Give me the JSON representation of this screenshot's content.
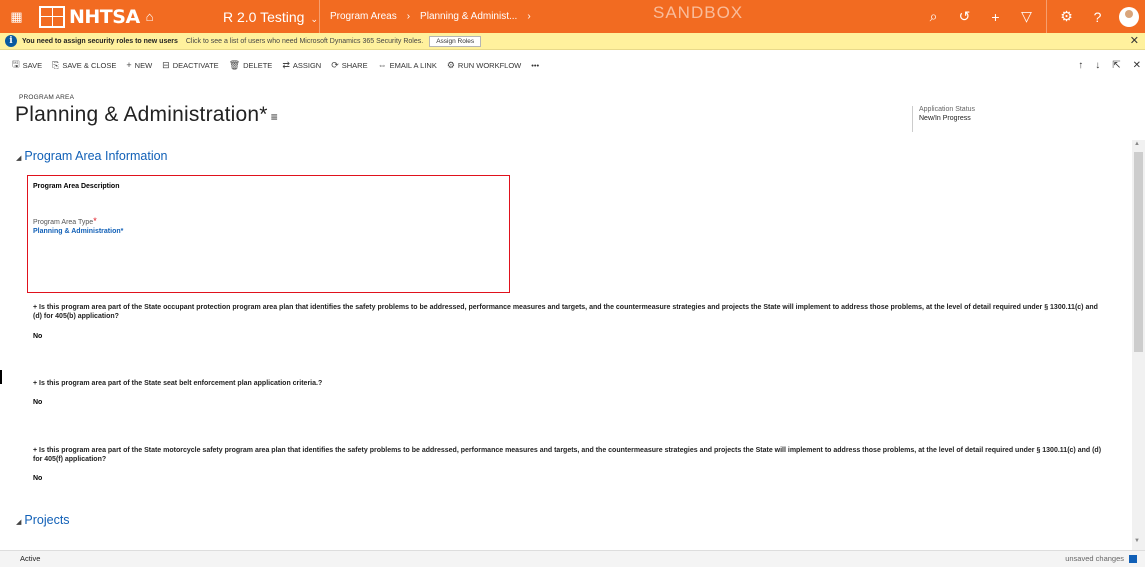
{
  "topbar": {
    "brand": "NHTSA",
    "environment": "R 2.0 Testing",
    "breadcrumbs": [
      "Program Areas",
      "Planning & Administ..."
    ],
    "watermark": "SANDBOX"
  },
  "notification": {
    "message": "You need to assign security roles to new users",
    "link_text": "Click to see a list of users who need Microsoft Dynamics 365 Security Roles.",
    "button_label": "Assign Roles"
  },
  "commands": [
    {
      "label": "SAVE",
      "icon": "save-icon"
    },
    {
      "label": "SAVE & CLOSE",
      "icon": "save-close-icon"
    },
    {
      "label": "NEW",
      "icon": "plus-icon"
    },
    {
      "label": "DEACTIVATE",
      "icon": "deactivate-icon"
    },
    {
      "label": "DELETE",
      "icon": "trash-icon"
    },
    {
      "label": "ASSIGN",
      "icon": "assign-icon"
    },
    {
      "label": "SHARE",
      "icon": "share-icon"
    },
    {
      "label": "EMAIL A LINK",
      "icon": "link-icon"
    },
    {
      "label": "RUN WORKFLOW",
      "icon": "workflow-icon"
    },
    {
      "label": "•••",
      "icon": "more-icon"
    }
  ],
  "header": {
    "entity": "PROGRAM AREA",
    "title": "Planning & Administration*",
    "status_label": "Application Status",
    "status_value": "New/In Progress"
  },
  "sections": {
    "info_title": "Program Area Information",
    "projects_title": "Projects"
  },
  "form": {
    "description_label": "Program Area Description",
    "type_label": "Program Area Type",
    "type_value": "Planning & Administration*"
  },
  "questions": [
    {
      "text": "Is this program area part of the State occupant protection program area plan that identifies the safety problems to be addressed, performance measures and targets, and the countermeasure strategies and projects the State will implement to address those problems, at the level of detail required under § 1300.11(c) and (d) for 405(b) application?",
      "answer": "No"
    },
    {
      "text": "Is this program area part of the State seat belt enforcement plan application criteria.?",
      "answer": "No"
    },
    {
      "text": "Is this program area part of the State motorcycle safety program area plan that identifies the safety problems to be addressed, performance measures and targets, and the countermeasure strategies and projects the State will implement to address those problems, at the level of detail required under § 1300.11(c) and (d) for 405(f) application?",
      "answer": "No"
    }
  ],
  "status": {
    "state": "Active",
    "changes": "unsaved changes"
  }
}
